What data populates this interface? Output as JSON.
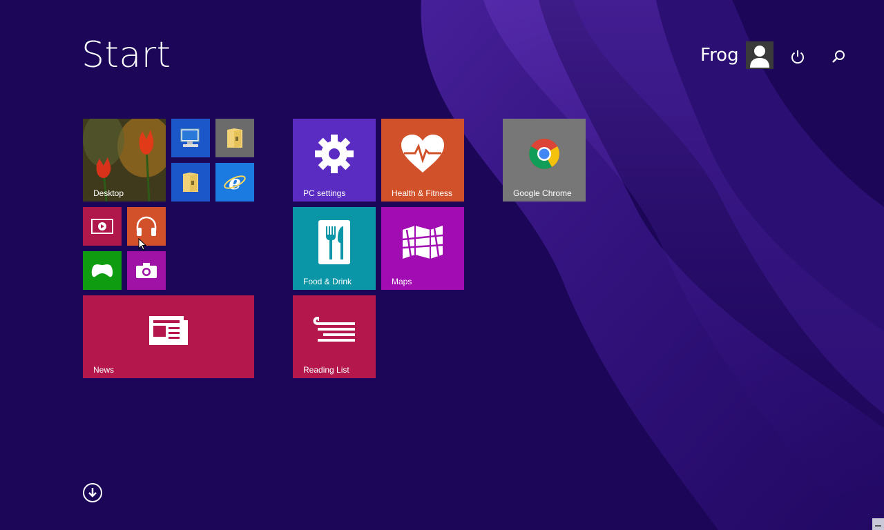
{
  "screen": {
    "title": "Start"
  },
  "user": {
    "name": "Frog",
    "avatar_icon": "user-avatar-icon"
  },
  "header": {
    "power_icon": "power-icon",
    "search_icon": "search-icon"
  },
  "tiles": {
    "desktop": {
      "label": "Desktop",
      "icon": "tulip-wallpaper"
    },
    "this_pc": {
      "icon": "computer-icon",
      "color": "#1b57c9"
    },
    "folder_gray": {
      "icon": "folder-icon",
      "color": "#6b6b6b"
    },
    "file_explorer": {
      "icon": "file-explorer-icon",
      "color": "#1b57c9"
    },
    "internet_explorer": {
      "icon": "internet-explorer-icon",
      "color": "#1b7be0"
    },
    "video": {
      "icon": "video-icon",
      "color": "#b0174b"
    },
    "music": {
      "icon": "headphones-icon",
      "color": "#d2502a"
    },
    "games": {
      "icon": "game-controller-icon",
      "color": "#109c10"
    },
    "camera": {
      "icon": "camera-icon",
      "color": "#a012a5"
    },
    "news": {
      "label": "News",
      "icon": "news-icon",
      "color": "#b3174b"
    },
    "pc_settings": {
      "label": "PC settings",
      "icon": "gear-icon",
      "color": "#5a2cc2"
    },
    "health": {
      "label": "Health & Fitness",
      "icon": "heart-pulse-icon",
      "color": "#d1512a"
    },
    "food": {
      "label": "Food & Drink",
      "icon": "fork-knife-icon",
      "color": "#0b96a8"
    },
    "maps": {
      "label": "Maps",
      "icon": "map-icon",
      "color": "#a10db2"
    },
    "reading_list": {
      "label": "Reading List",
      "icon": "reading-list-icon",
      "color": "#b3174b"
    },
    "chrome": {
      "label": "Google Chrome",
      "icon": "chrome-icon",
      "color": "#777777"
    }
  },
  "footer": {
    "all_apps_icon": "arrow-down-circle-icon"
  }
}
